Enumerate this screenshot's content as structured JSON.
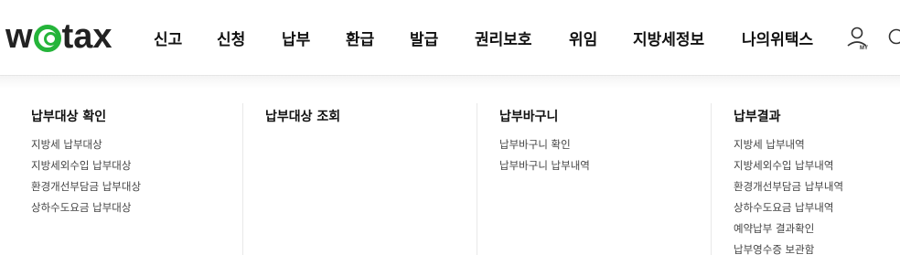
{
  "brand": {
    "logo_text_left": "w",
    "logo_text_right": "tax",
    "accent": "#25b43a"
  },
  "gnb": {
    "items": [
      "신고",
      "신청",
      "납부",
      "환급",
      "발급",
      "권리보호",
      "위임",
      "지방세정보",
      "나의위택스"
    ]
  },
  "header_icons": {
    "user": "user-my-icon",
    "user_badge": "MY",
    "search": "search-icon"
  },
  "megamenu": {
    "columns": [
      {
        "title": "납부대상 확인",
        "items": [
          "지방세 납부대상",
          "지방세외수입 납부대상",
          "환경개선부담금 납부대상",
          "상하수도요금 납부대상"
        ]
      },
      {
        "title": "납부대상 조회",
        "items": []
      },
      {
        "title": "납부바구니",
        "items": [
          "납부바구니 확인",
          "납부바구니 납부내역"
        ]
      },
      {
        "title": "납부결과",
        "items": [
          "지방세 납부내역",
          "지방세외수입 납부내역",
          "환경개선부담금 납부내역",
          "상하수도요금 납부내역",
          "예약납부 결과확인",
          "납부영수증 보관함"
        ]
      }
    ]
  }
}
